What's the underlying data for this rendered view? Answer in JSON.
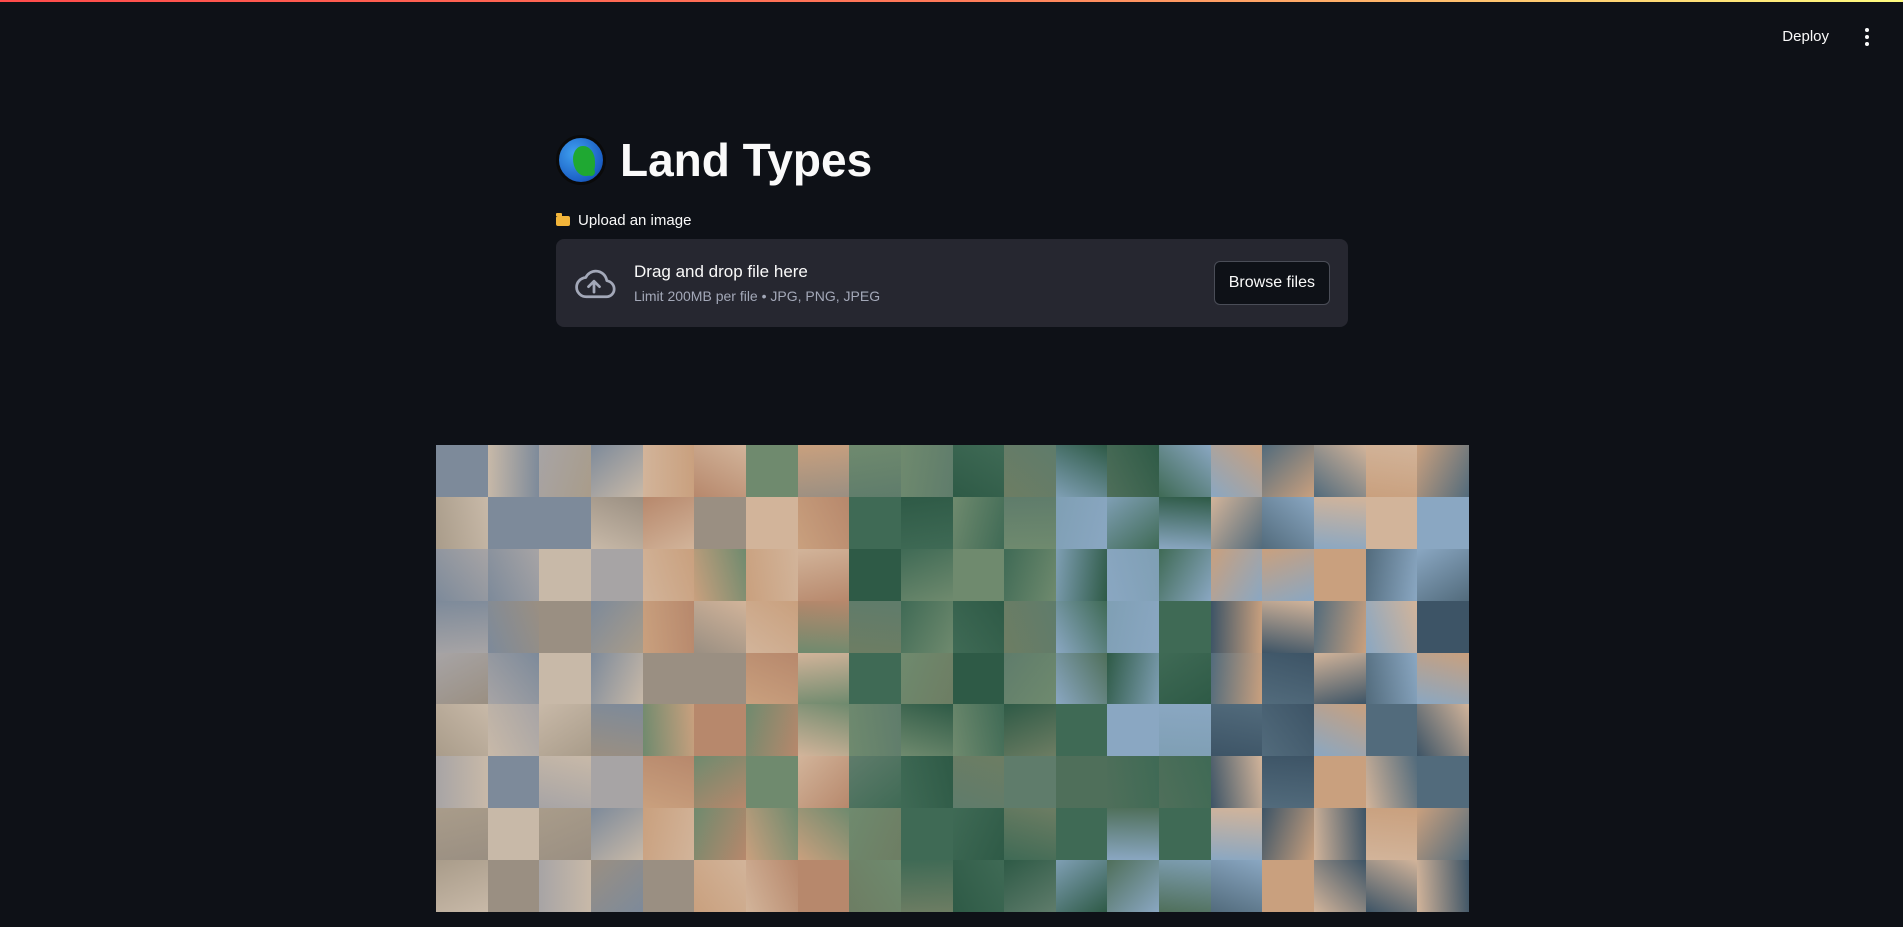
{
  "toolbar": {
    "deploy_label": "Deploy",
    "menu_icon": "vertical-ellipsis-icon"
  },
  "main": {
    "title_icon": "globe-africa-icon",
    "title": "Land Types",
    "uploader": {
      "label_icon": "open-folder-icon",
      "label": "Upload an image",
      "dropzone_icon": "cloud-upload-icon",
      "dropzone_title": "Drag and drop file here",
      "dropzone_subtitle": "Limit 200MB per file • JPG, PNG, JPEG",
      "browse_label": "Browse files"
    }
  },
  "image": {
    "description_name": "satellite-land-type-mosaic",
    "palette": [
      "#a7a4a5",
      "#c8b9a8",
      "#7d8a9a",
      "#9a8f82",
      "#c9a07e",
      "#b7886c",
      "#6f8a6e",
      "#3f6a55",
      "#5f7c6b",
      "#2e5a46",
      "#7f9fb4",
      "#4f6f5a",
      "#8aa7c2",
      "#d2b49a",
      "#3d5466",
      "#a99c8a",
      "#6d7d63",
      "#526b7c"
    ]
  }
}
